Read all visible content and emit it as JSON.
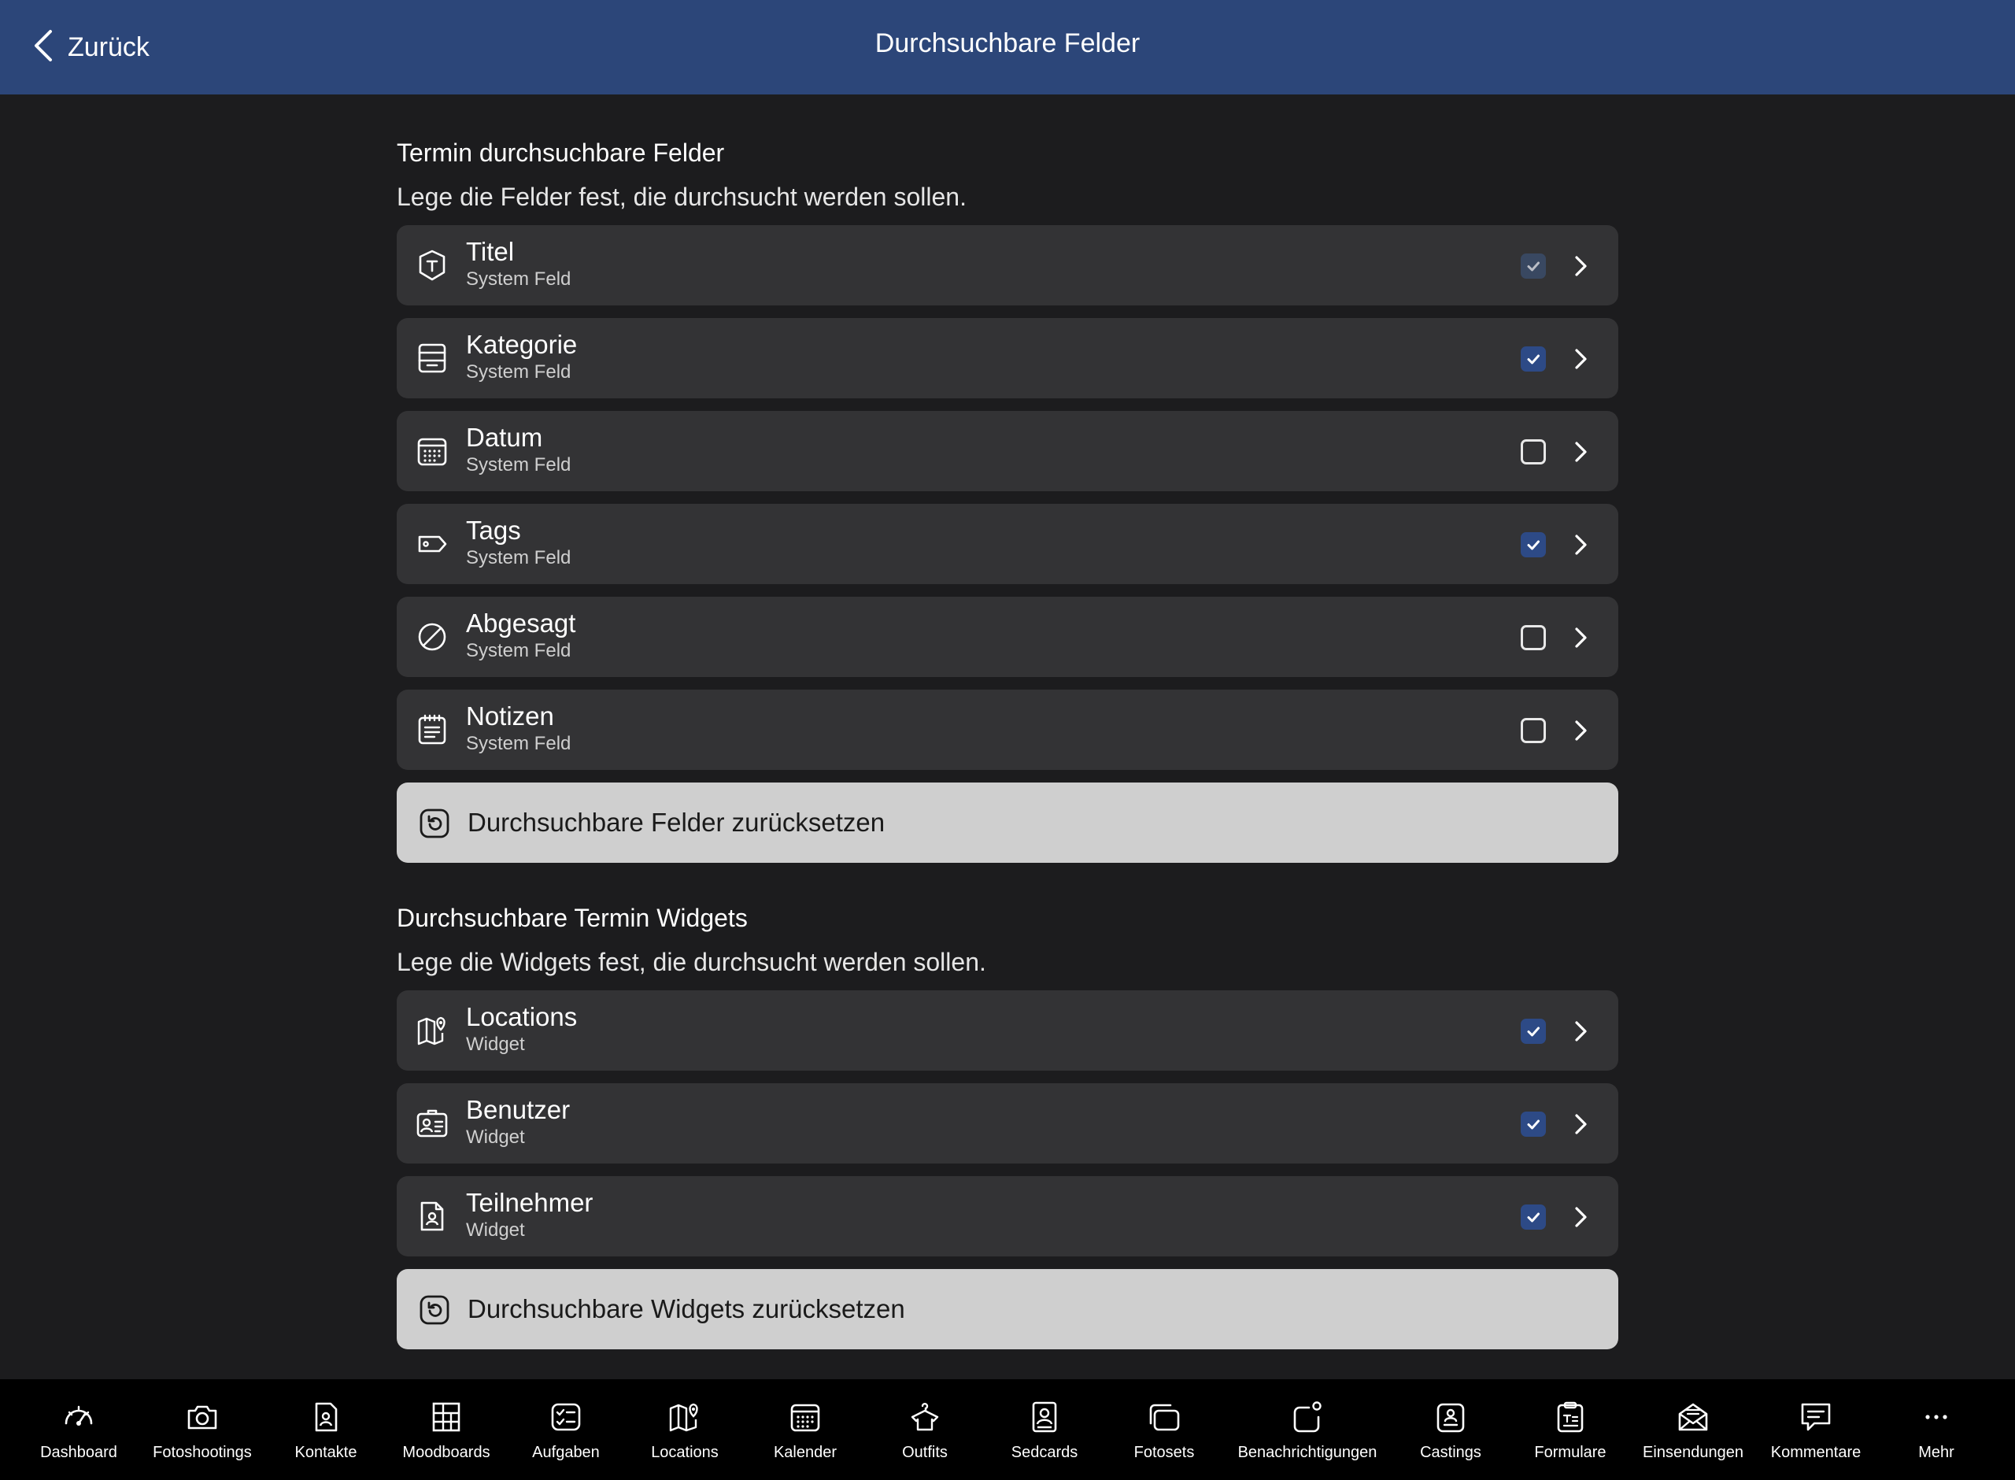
{
  "header": {
    "back_label": "Zurück",
    "title": "Durchsuchbare Felder"
  },
  "fields_section": {
    "title": "Termin durchsuchbare Felder",
    "description": "Lege die Felder fest, die durchsucht werden sollen.",
    "items": [
      {
        "title": "Titel",
        "subtitle": "System Feld",
        "checked": true,
        "icon": "title-tag-icon"
      },
      {
        "title": "Kategorie",
        "subtitle": "System Feld",
        "checked": true,
        "icon": "category-stack-icon"
      },
      {
        "title": "Datum",
        "subtitle": "System Feld",
        "checked": false,
        "icon": "calendar-icon"
      },
      {
        "title": "Tags",
        "subtitle": "System Feld",
        "checked": true,
        "icon": "tag-icon"
      },
      {
        "title": "Abgesagt",
        "subtitle": "System Feld",
        "checked": false,
        "icon": "cancel-circle-icon"
      },
      {
        "title": "Notizen",
        "subtitle": "System Feld",
        "checked": false,
        "icon": "notes-icon"
      }
    ],
    "reset_label": "Durchsuchbare Felder zurücksetzen"
  },
  "widgets_section": {
    "title": "Durchsuchbare Termin Widgets",
    "description": "Lege die Widgets fest, die durchsucht werden sollen.",
    "items": [
      {
        "title": "Locations",
        "subtitle": "Widget",
        "checked": true,
        "icon": "map-pin-icon"
      },
      {
        "title": "Benutzer",
        "subtitle": "Widget",
        "checked": true,
        "icon": "id-card-icon"
      },
      {
        "title": "Teilnehmer",
        "subtitle": "Widget",
        "checked": true,
        "icon": "person-document-icon"
      }
    ],
    "reset_label": "Durchsuchbare Widgets zurücksetzen"
  },
  "tabbar": {
    "items": [
      {
        "label": "Dashboard",
        "icon": "dashboard-gauge-icon"
      },
      {
        "label": "Fotoshootings",
        "icon": "camera-icon"
      },
      {
        "label": "Kontakte",
        "icon": "contact-document-icon"
      },
      {
        "label": "Moodboards",
        "icon": "moodboard-grid-icon"
      },
      {
        "label": "Aufgaben",
        "icon": "tasks-checklist-icon"
      },
      {
        "label": "Locations",
        "icon": "map-pin-icon"
      },
      {
        "label": "Kalender",
        "icon": "calendar-icon"
      },
      {
        "label": "Outfits",
        "icon": "hanger-shirt-icon"
      },
      {
        "label": "Sedcards",
        "icon": "sedcard-portrait-icon"
      },
      {
        "label": "Fotosets",
        "icon": "photo-stack-icon"
      },
      {
        "label": "Benachrichtigungen",
        "icon": "notification-badge-icon"
      },
      {
        "label": "Castings",
        "icon": "casting-badge-icon"
      },
      {
        "label": "Formulare",
        "icon": "form-clipboard-icon"
      },
      {
        "label": "Einsendungen",
        "icon": "mail-envelope-icon"
      },
      {
        "label": "Kommentare",
        "icon": "comment-bubble-icon"
      },
      {
        "label": "Mehr",
        "icon": "more-dots-icon"
      }
    ]
  },
  "colors": {
    "header_bg": "#2c4679",
    "background": "#1c1c1e",
    "row_bg": "#333335",
    "checkbox_on": "#2d4a86",
    "reset_button_bg": "#cfcfcf",
    "tabbar_bg": "#000000"
  }
}
